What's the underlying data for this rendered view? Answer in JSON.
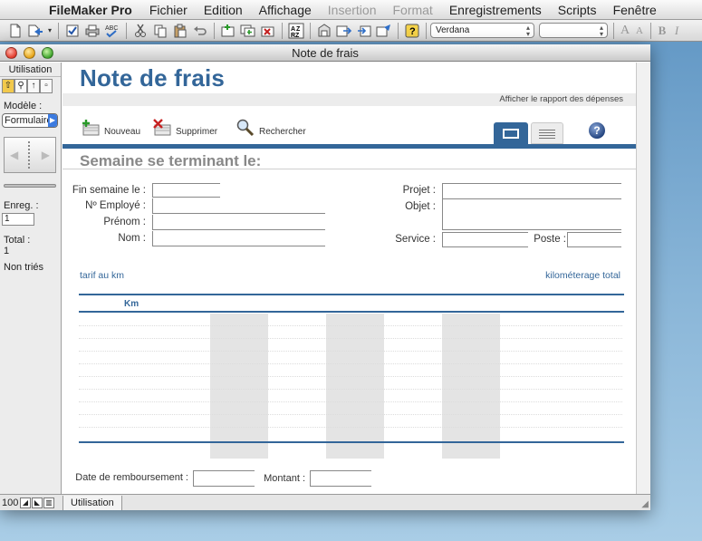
{
  "menubar": {
    "app_name": "FileMaker Pro",
    "items": [
      {
        "label": "Fichier",
        "enabled": true
      },
      {
        "label": "Edition",
        "enabled": true
      },
      {
        "label": "Affichage",
        "enabled": true
      },
      {
        "label": "Insertion",
        "enabled": false
      },
      {
        "label": "Format",
        "enabled": false
      },
      {
        "label": "Enregistrements",
        "enabled": true
      },
      {
        "label": "Scripts",
        "enabled": true
      },
      {
        "label": "Fenêtre",
        "enabled": true
      }
    ]
  },
  "toolbar": {
    "font_name": "Verdana",
    "size_value": "",
    "format_buttons": [
      "A",
      "A",
      "B",
      "I"
    ]
  },
  "window": {
    "title": "Note de frais"
  },
  "status_area": {
    "mode_label": "Utilisation",
    "layout_label": "Modèle :",
    "layout_value": "Formulaire",
    "record_label": "Enreg. :",
    "record_value": "1",
    "total_label": "Total :",
    "total_value": "1",
    "sort_status": "Non triés"
  },
  "bottom_bar": {
    "zoom": "100",
    "mode": "Utilisation"
  },
  "form": {
    "title": "Note de frais",
    "report_link": "Afficher le rapport des dépenses",
    "actions": {
      "new": "Nouveau",
      "delete": "Supprimer",
      "find": "Rechercher"
    },
    "help_glyph": "?",
    "week_heading": "Semaine se terminant le:",
    "labels": {
      "week_end": "Fin semaine le :",
      "employee_no": "Nº Employé :",
      "first_name": "Prénom :",
      "last_name": "Nom :",
      "project": "Projet :",
      "purpose": "Objet :",
      "department": "Service :",
      "extension": "Poste :"
    },
    "values": {
      "week_end": "",
      "employee_no": "",
      "first_name": "",
      "last_name": "",
      "project": "",
      "purpose": "",
      "department": "",
      "extension": ""
    },
    "table": {
      "rate_header": "tarif au km",
      "mileage_total_header": "kilométerage total",
      "km_header": "Km"
    },
    "footer": {
      "reimbursement_label": "Date de remboursement :",
      "amount_label": "Montant :",
      "reimbursement_value": "",
      "amount_value": ""
    }
  }
}
